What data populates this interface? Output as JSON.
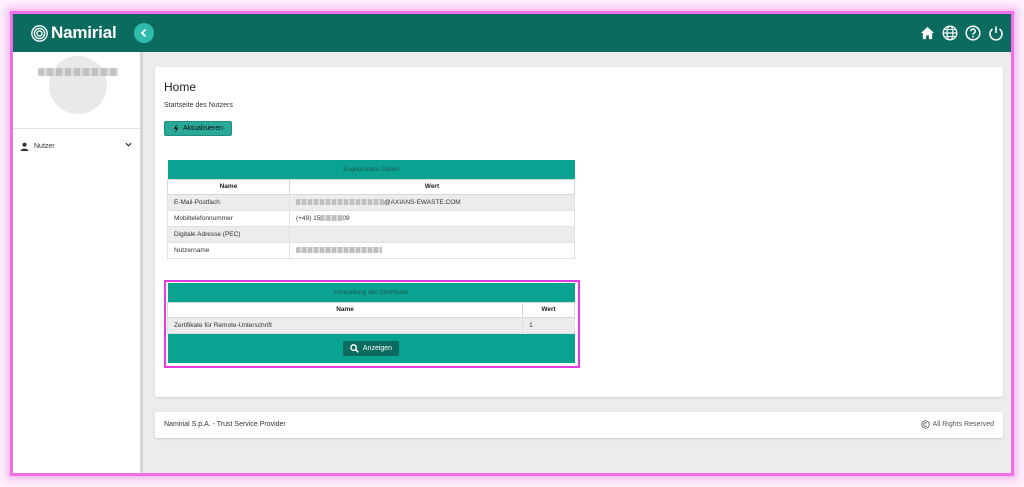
{
  "topbar": {
    "brand": "Namirial",
    "icons": [
      "home-icon",
      "globe-icon",
      "help-icon",
      "power-icon"
    ],
    "color": "#0c6b5f"
  },
  "sidebar": {
    "nav_label": "Nutzer"
  },
  "main": {
    "title": "Home",
    "subtitle": "Startseite des Nutzers",
    "refresh_label": "Aktualisieren",
    "assigned": {
      "caption": "Zugeordnete Daten",
      "headers": [
        "Name",
        "Wert"
      ],
      "rows": [
        {
          "name": "E-Mail-Postfach",
          "value": "@AXIANS-EWASTE.COM"
        },
        {
          "name": "Mobiltelefonnummer",
          "value_prefix": "(+49) 15",
          "value_suffix": "09"
        },
        {
          "name": "Digitale Adresse (PEC)",
          "value": ""
        },
        {
          "name": "Nutzername",
          "value": ""
        }
      ]
    },
    "certificates": {
      "caption": "Verwaltung der Zertifikate",
      "headers": [
        "Name",
        "Wert"
      ],
      "rows": [
        {
          "name": "Zertifikate für Remote-Unterschrift",
          "value": "1"
        }
      ],
      "show_label": "Anzeigen"
    }
  },
  "footer": {
    "company": "Namirial S.p.A. - Trust Service Provider",
    "rights": "All Rights Reserved"
  },
  "colors": {
    "accent": "#0aa392",
    "button": "#2aa999",
    "highlight": "#e43be0"
  }
}
